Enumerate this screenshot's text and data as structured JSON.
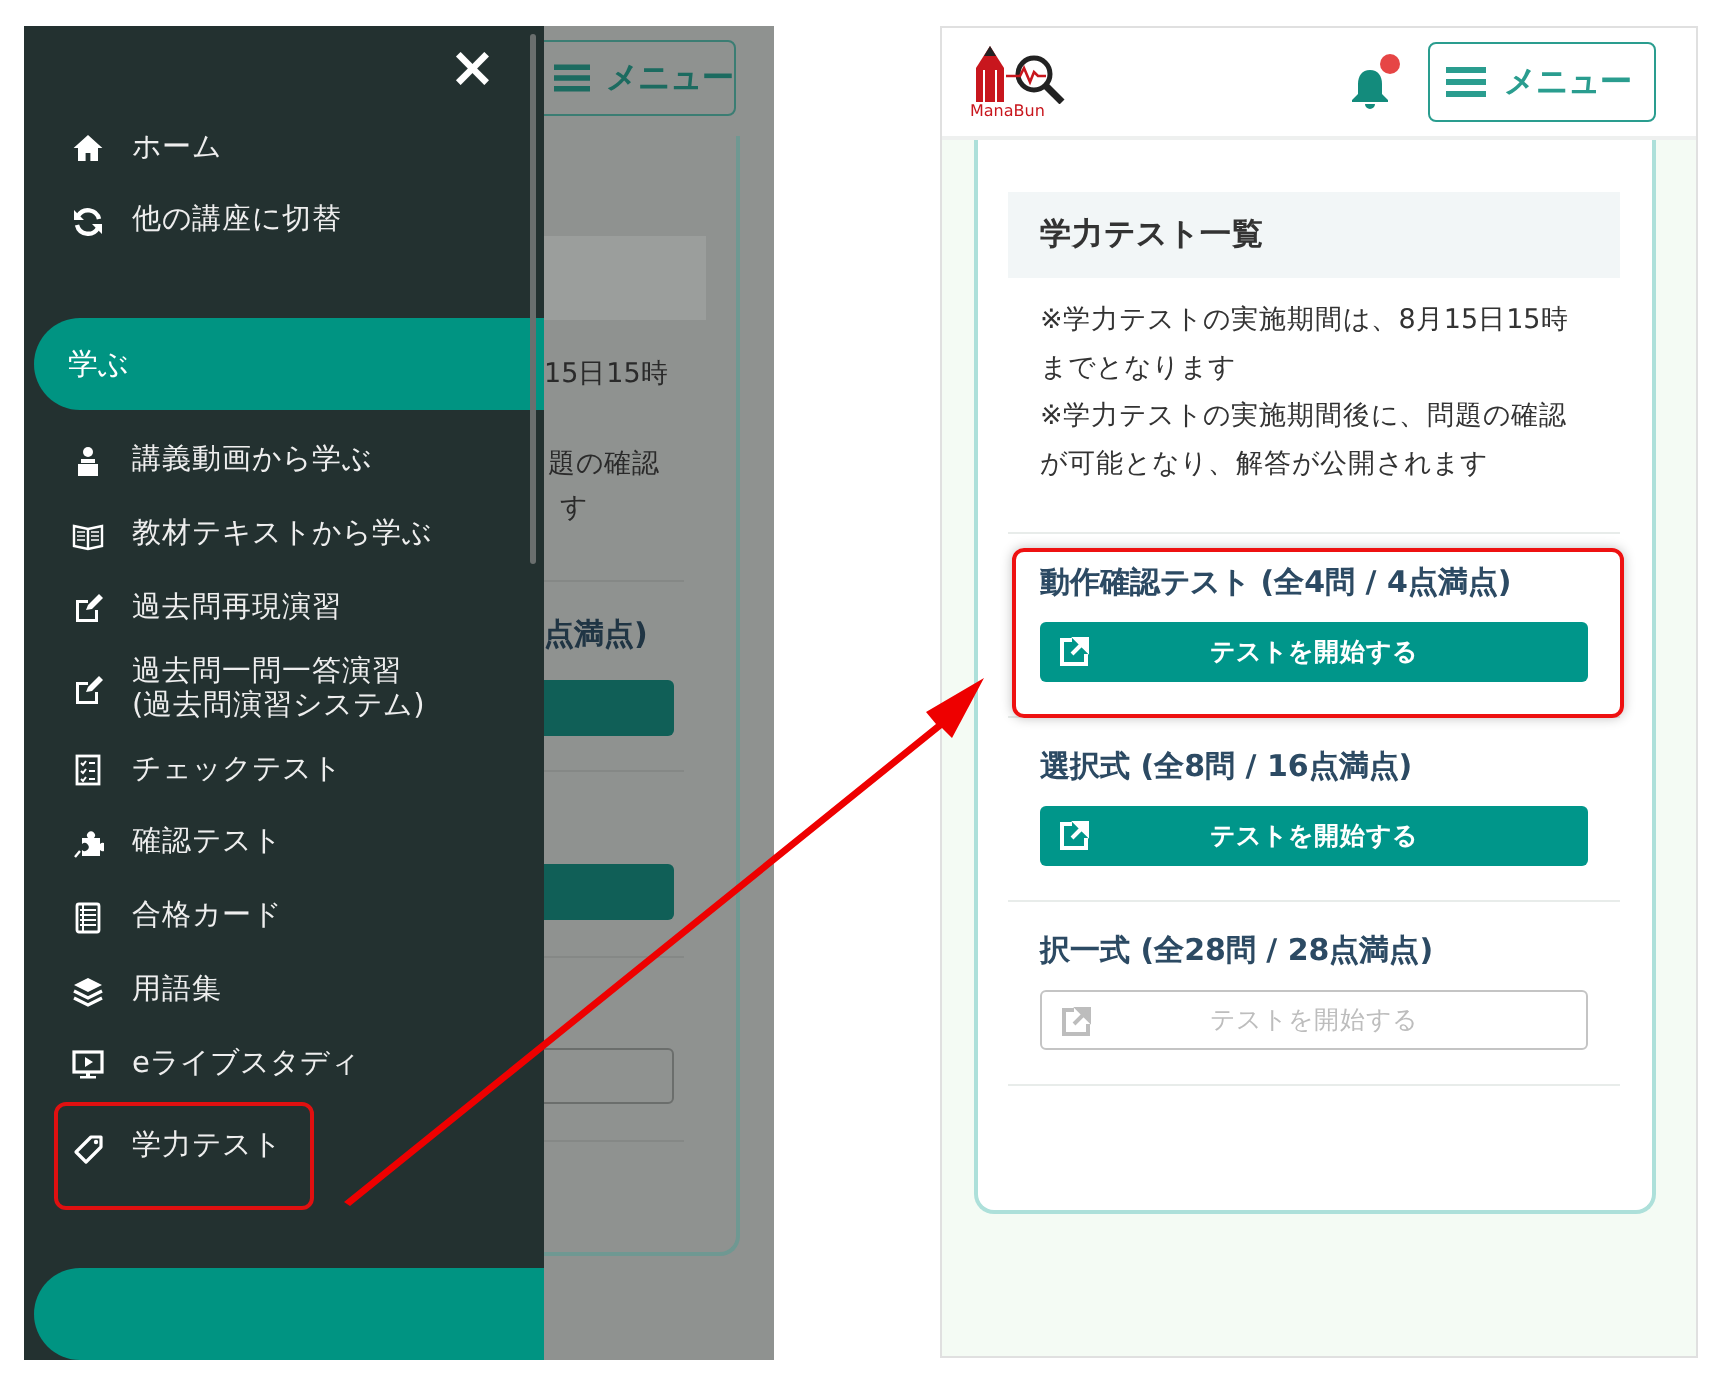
{
  "left_screenshot": {
    "background": {
      "menu_button": "メニュー",
      "fragments": [
        "15日15時",
        "題の確認",
        "す",
        "点満点)"
      ]
    },
    "drawer": {
      "close": "×",
      "items": [
        {
          "kind": "link",
          "label": "ホーム",
          "marked": false
        },
        {
          "kind": "link",
          "label": "他の講座に切替",
          "marked": false
        },
        {
          "kind": "section",
          "label": "学ぶ"
        },
        {
          "kind": "link",
          "label": "講義動画から学ぶ",
          "marked": false
        },
        {
          "kind": "link",
          "label": "教材テキストから学ぶ",
          "marked": false
        },
        {
          "kind": "link",
          "label": "過去問再現演習",
          "marked": false
        },
        {
          "kind": "link",
          "label": "過去問一問一答演習\n(過去問演習システム)",
          "marked": false
        },
        {
          "kind": "link",
          "label": "チェックテスト",
          "marked": false
        },
        {
          "kind": "link",
          "label": "確認テスト",
          "marked": false
        },
        {
          "kind": "link",
          "label": "合格カード",
          "marked": false
        },
        {
          "kind": "link",
          "label": "用語集",
          "marked": false
        },
        {
          "kind": "link",
          "label": "eライブスタディ",
          "marked": false
        },
        {
          "kind": "link",
          "label": "学力テスト",
          "marked": true
        },
        {
          "kind": "section"
        }
      ]
    }
  },
  "right_screenshot": {
    "logo_text": "ManaBun",
    "bell": {
      "unread": true
    },
    "menu_button": "メニュー",
    "list_title": "学力テスト一覧",
    "notes": [
      "※学力テストの実施期間は、8月15日15時までとなります",
      "※学力テストの実施期間後に、問題の確認が可能となり、解答が公開されます"
    ],
    "tests": [
      {
        "title": "動作確認テスト (全4問 / 4点満点)",
        "button": "テストを開始する",
        "disabled": false,
        "marked": true
      },
      {
        "title": "選択式 (全8問 / 16点満点)",
        "button": "テストを開始する",
        "disabled": false,
        "marked": false
      },
      {
        "title": "択一式 (全28問 / 28点満点)",
        "button": "テストを開始する",
        "disabled": true,
        "marked": false
      }
    ]
  }
}
